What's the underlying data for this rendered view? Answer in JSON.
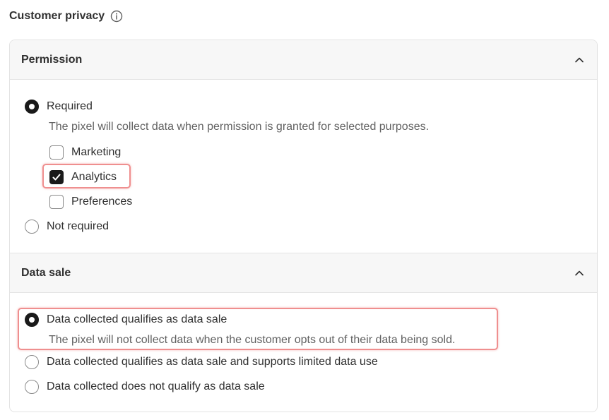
{
  "page": {
    "title": "Customer privacy",
    "info_icon": "info-icon"
  },
  "permission": {
    "header": "Permission",
    "collapse_icon": "chevron-up-icon",
    "options": [
      {
        "label": "Required",
        "selected": true
      },
      {
        "label": "Not required",
        "selected": false
      }
    ],
    "helper": "The pixel will collect data when permission is granted for selected purposes.",
    "purposes": [
      {
        "label": "Marketing",
        "checked": false
      },
      {
        "label": "Analytics",
        "checked": true
      },
      {
        "label": "Preferences",
        "checked": false
      }
    ]
  },
  "data_sale": {
    "header": "Data sale",
    "collapse_icon": "chevron-up-icon",
    "options": [
      {
        "label": "Data collected qualifies as data sale",
        "selected": true
      },
      {
        "label": "Data collected qualifies as data sale and supports limited data use",
        "selected": false
      },
      {
        "label": "Data collected does not qualify as data sale",
        "selected": false
      }
    ],
    "helper": "The pixel will not collect data when the customer opts out of their data being sold."
  },
  "colors": {
    "accent": "#1a1a1a",
    "highlight": "#ef8f8f",
    "header_bg": "#f7f7f7",
    "border": "#e3e3e3",
    "helper_text": "#616161"
  }
}
